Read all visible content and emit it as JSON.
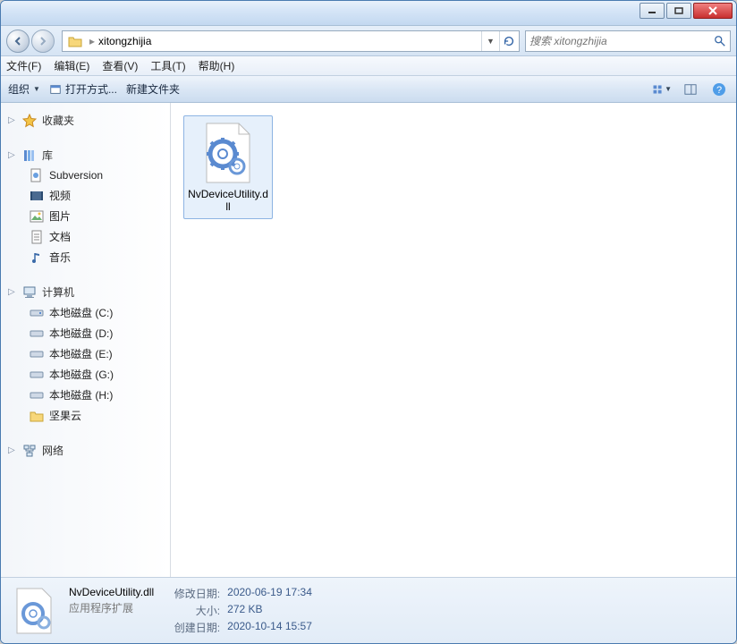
{
  "titlebar": {
    "minimize": "minimize",
    "maximize": "maximize",
    "close": "close"
  },
  "address": {
    "path": "xitongzhijia",
    "search_placeholder": "搜索 xitongzhijia"
  },
  "menubar": {
    "file": "文件(F)",
    "edit": "编辑(E)",
    "view": "查看(V)",
    "tools": "工具(T)",
    "help": "帮助(H)"
  },
  "toolbar": {
    "organize": "组织",
    "open_with": "打开方式...",
    "new_folder": "新建文件夹"
  },
  "sidebar": {
    "favorites": "收藏夹",
    "libraries": "库",
    "lib_items": {
      "subversion": "Subversion",
      "videos": "视频",
      "pictures": "图片",
      "documents": "文档",
      "music": "音乐"
    },
    "computer": "计算机",
    "drives": {
      "c": "本地磁盘 (C:)",
      "d": "本地磁盘 (D:)",
      "e": "本地磁盘 (E:)",
      "g": "本地磁盘 (G:)",
      "h": "本地磁盘 (H:)"
    },
    "jianguoyun": "坚果云",
    "network": "网络"
  },
  "content": {
    "file_name": "NvDeviceUtility.dll"
  },
  "details": {
    "file_name": "NvDeviceUtility.dll",
    "file_type": "应用程序扩展",
    "modified_label": "修改日期:",
    "modified_value": "2020-06-19 17:34",
    "size_label": "大小:",
    "size_value": "272 KB",
    "created_label": "创建日期:",
    "created_value": "2020-10-14 15:57"
  }
}
